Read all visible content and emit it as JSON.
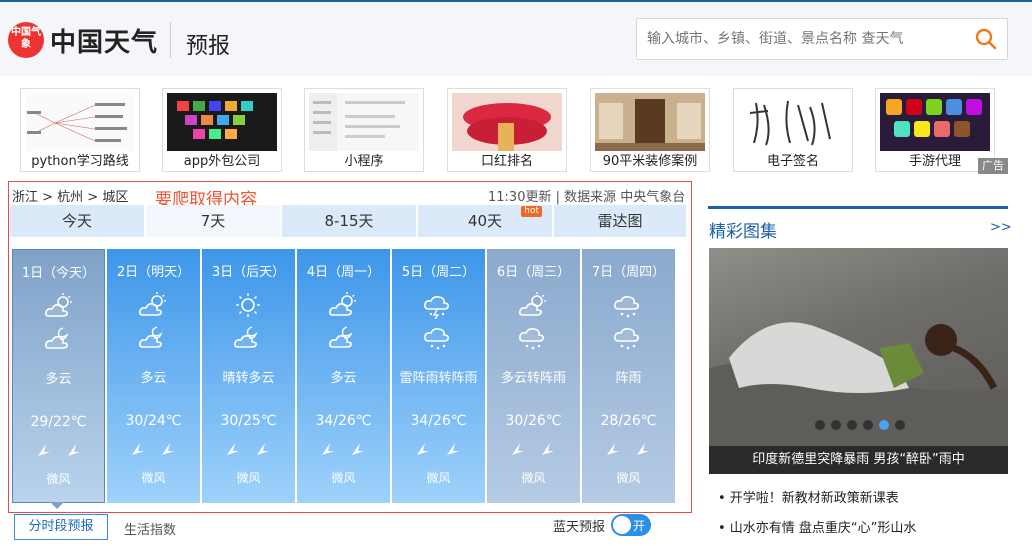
{
  "header": {
    "logo_text": "中国气象",
    "brand": "中国天气",
    "section": "预报",
    "search_placeholder": "输入城市、乡镇、街道、景点名称 查天气"
  },
  "ads": [
    {
      "caption": "python学习路线"
    },
    {
      "caption": "app外包公司"
    },
    {
      "caption": "小程序"
    },
    {
      "caption": "口红排名"
    },
    {
      "caption": "90平米装修案例"
    },
    {
      "caption": "电子签名"
    },
    {
      "caption": "手游代理"
    }
  ],
  "ad_tag": "广告",
  "weather": {
    "breadcrumb": "浙江 > 杭州 > 城区",
    "annotation": "要爬取得内容",
    "update_time": "11:30更新 | 数据来源 中央气象台",
    "tabs": [
      {
        "label": "今天"
      },
      {
        "label": "7天"
      },
      {
        "label": "8-15天"
      },
      {
        "label": "40天",
        "badge": "hot"
      },
      {
        "label": "雷达图"
      }
    ],
    "days": [
      {
        "date": "1日（今天）",
        "weather": "多云",
        "temp": "29/22℃",
        "wind": "微风"
      },
      {
        "date": "2日（明天）",
        "weather": "多云",
        "temp": "30/24℃",
        "wind": "微风"
      },
      {
        "date": "3日（后天）",
        "weather": "晴转多云",
        "temp": "30/25℃",
        "wind": "微风"
      },
      {
        "date": "4日（周一）",
        "weather": "多云",
        "temp": "34/26℃",
        "wind": "微风"
      },
      {
        "date": "5日（周二）",
        "weather": "雷阵雨转阵雨",
        "temp": "34/26℃",
        "wind": "微风"
      },
      {
        "date": "6日（周三）",
        "weather": "多云转阵雨",
        "temp": "30/26℃",
        "wind": "微风"
      },
      {
        "date": "7日（周四）",
        "weather": "阵雨",
        "temp": "28/26℃",
        "wind": "微风"
      }
    ],
    "subtabs": [
      "分时段预报",
      "生活指数"
    ],
    "bluesky_label": "蓝天预报",
    "toggle_label": "开"
  },
  "gallery": {
    "title": "精彩图集",
    "more": ">>",
    "caption": "印度新德里突降暴雨 男孩“醉卧”雨中",
    "news": [
      "• 开学啦！新教材新政策新课表",
      "• 山水亦有情 盘点重庆“心”形山水"
    ]
  }
}
